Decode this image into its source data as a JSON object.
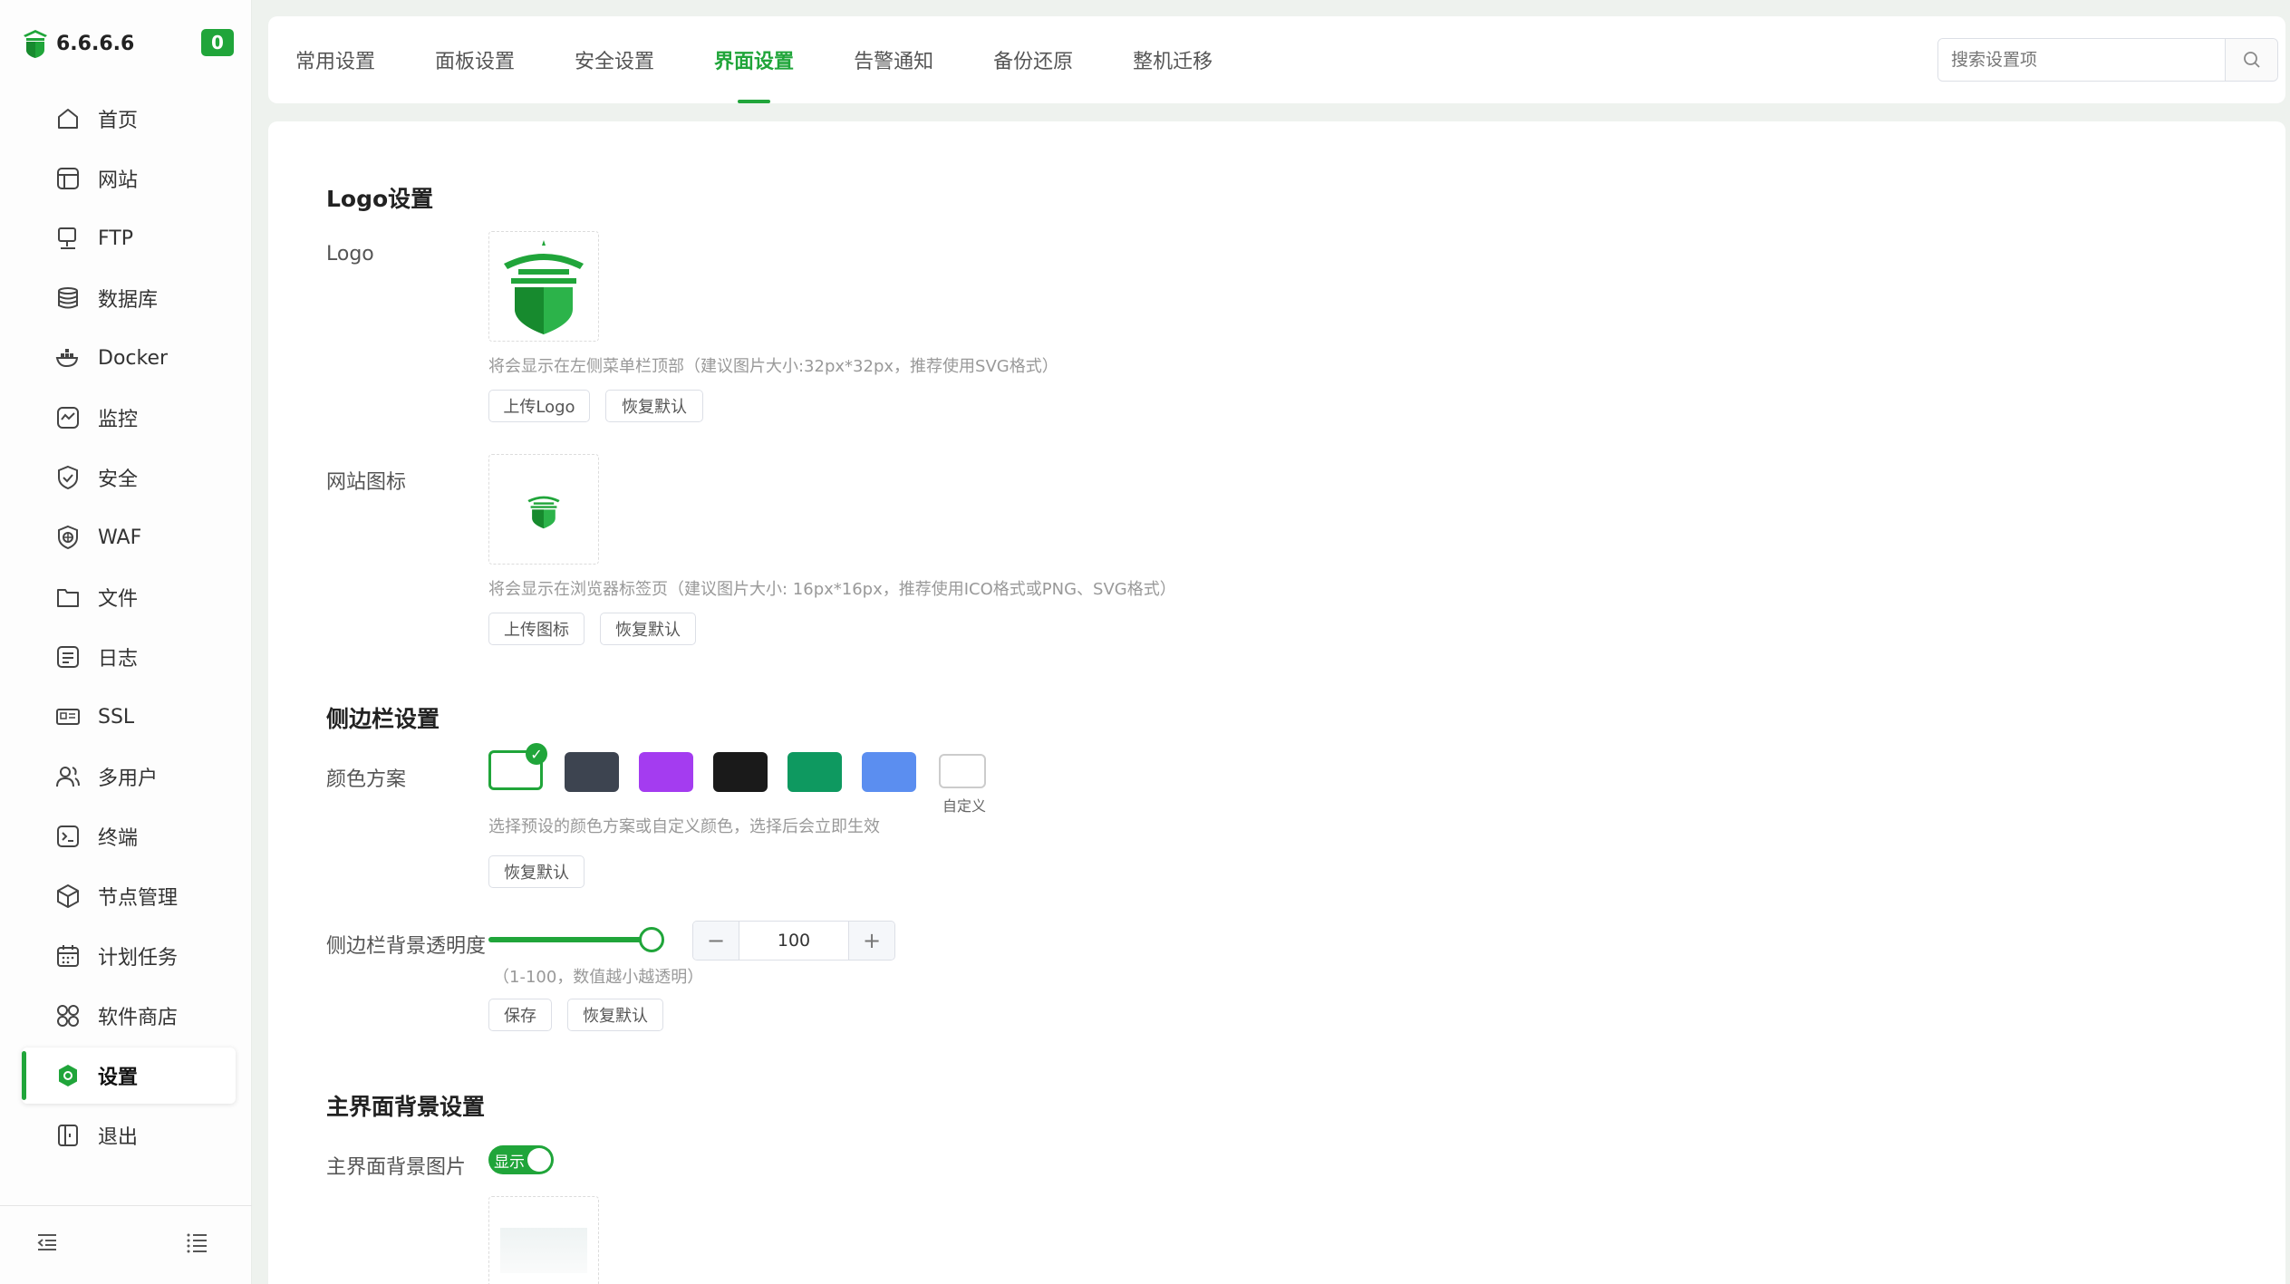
{
  "brand": {
    "ip": "6.6.6.6",
    "badge": "0"
  },
  "sidebar": {
    "items": [
      {
        "label": "首页",
        "icon": "home-icon"
      },
      {
        "label": "网站",
        "icon": "globe-icon"
      },
      {
        "label": "FTP",
        "icon": "ftp-icon"
      },
      {
        "label": "数据库",
        "icon": "database-icon"
      },
      {
        "label": "Docker",
        "icon": "docker-icon"
      },
      {
        "label": "监控",
        "icon": "monitor-icon"
      },
      {
        "label": "安全",
        "icon": "shield-icon"
      },
      {
        "label": "WAF",
        "icon": "waf-icon"
      },
      {
        "label": "文件",
        "icon": "folder-icon"
      },
      {
        "label": "日志",
        "icon": "log-icon"
      },
      {
        "label": "SSL",
        "icon": "ssl-icon"
      },
      {
        "label": "多用户",
        "icon": "users-icon"
      },
      {
        "label": "终端",
        "icon": "terminal-icon"
      },
      {
        "label": "节点管理",
        "icon": "cube-icon"
      },
      {
        "label": "计划任务",
        "icon": "calendar-icon"
      },
      {
        "label": "软件商店",
        "icon": "apps-icon"
      },
      {
        "label": "设置",
        "icon": "settings-icon"
      },
      {
        "label": "退出",
        "icon": "logout-icon"
      }
    ],
    "active_index": 16
  },
  "tabs": [
    "常用设置",
    "面板设置",
    "安全设置",
    "界面设置",
    "告警通知",
    "备份还原",
    "整机迁移"
  ],
  "active_tab": 3,
  "search": {
    "placeholder": "搜索设置项"
  },
  "logo_section": {
    "title": "Logo设置",
    "logo_label": "Logo",
    "logo_hint": "将会显示在左侧菜单栏顶部（建议图片大小:32px*32px，推荐使用SVG格式）",
    "upload_logo": "上传Logo",
    "reset": "恢复默认",
    "favicon_label": "网站图标",
    "favicon_hint": "将会显示在浏览器标签页（建议图片大小: 16px*16px，推荐使用ICO格式或PNG、SVG格式）",
    "upload_favicon": "上传图标"
  },
  "sidebar_section": {
    "title": "侧边栏设置",
    "color_label": "颜色方案",
    "colors": [
      "#ffffff",
      "#3d4450",
      "#a43cf0",
      "#1a1a1a",
      "#0e9960",
      "#5b8ef0"
    ],
    "custom_label": "自定义",
    "color_hint": "选择预设的颜色方案或自定义颜色，选择后会立即生效",
    "reset": "恢复默认",
    "opacity_label": "侧边栏背景透明度",
    "opacity_value": "100",
    "opacity_fraction": 1.0,
    "opacity_hint": "（1-100，数值越小越透明）",
    "save": "保存"
  },
  "main_bg_section": {
    "title": "主界面背景设置",
    "bg_image_label": "主界面背景图片",
    "toggle_text": "显示"
  },
  "accent": "#20a53a"
}
